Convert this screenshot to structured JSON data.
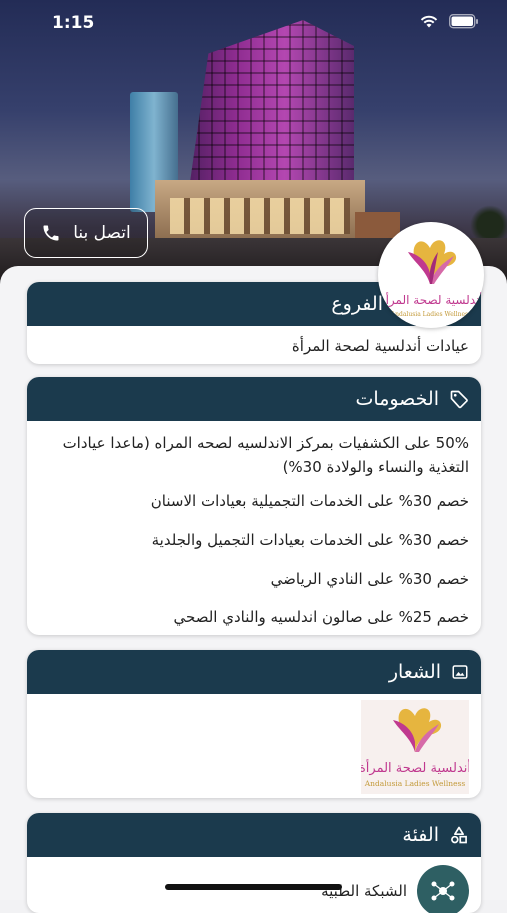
{
  "status_bar": {
    "time": "1:15"
  },
  "hero": {
    "call_button_label": "اتصل بنا"
  },
  "logo": {
    "brand_arabic": "أندلسية لصحة المرأة",
    "brand_english": "Andalusia Ladies Wellness"
  },
  "branches": {
    "title": "الفروع",
    "items": [
      "عيادات أندلسية لصحة المرأة"
    ]
  },
  "discounts": {
    "title": "الخصومات",
    "items": [
      "50% على الكشفيات بمركز الاندلسيه لصحه المراه (ماعدا عيادات التغذية والنساء والولادة 30%)",
      "خصم 30% على الخدمات التجميلية بعيادات الاسنان",
      "خصم 30% على الخدمات بعيادات التجميل والجلدية",
      "خصم 30% على النادي الرياضي",
      "خصم 25% على صالون اندلسيه والنادي الصحي"
    ]
  },
  "logo_section": {
    "title": "الشعار"
  },
  "category": {
    "title": "الفئة",
    "value": "الشبكة الطبية"
  },
  "colors": {
    "header": "#1b3a4d",
    "accent_pink": "#c0398f",
    "accent_gold": "#e0b13f"
  }
}
